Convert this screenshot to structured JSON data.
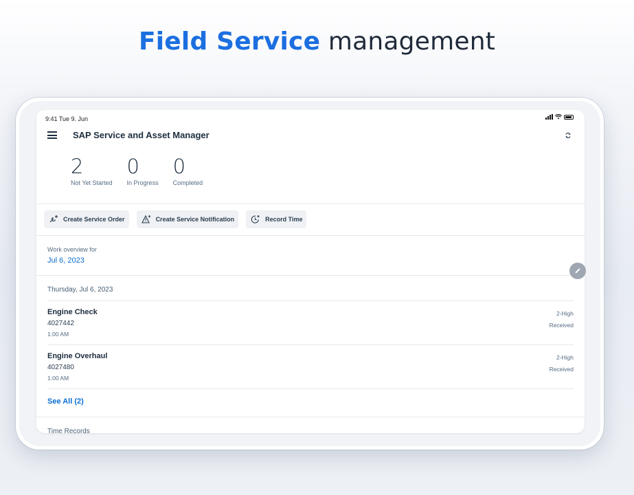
{
  "headline": {
    "accent": "Field Service",
    "rest": "management"
  },
  "status_bar": {
    "time": "9:41  Tue 9. Jun"
  },
  "app": {
    "title": "SAP Service and Asset Manager"
  },
  "kpis": [
    {
      "value": "2",
      "label": "Not Yet Started"
    },
    {
      "value": "0",
      "label": "In Progress"
    },
    {
      "value": "0",
      "label": "Completed"
    }
  ],
  "actions": [
    {
      "label": "Create Service Order",
      "icon": "wrench-plus-icon"
    },
    {
      "label": "Create Service Notification",
      "icon": "warning-plus-icon"
    },
    {
      "label": "Record Time",
      "icon": "clock-plus-icon"
    }
  ],
  "overview": {
    "label": "Work overview for",
    "date": "Jul 6, 2023"
  },
  "day_header": "Thursday, Jul 6, 2023",
  "orders": [
    {
      "title": "Engine Check",
      "id": "4027442",
      "time": "1:00 AM",
      "priority": "2-High",
      "status": "Received"
    },
    {
      "title": "Engine Overhaul",
      "id": "4027480",
      "time": "1:00 AM",
      "priority": "2-High",
      "status": "Received"
    }
  ],
  "see_all": "See All (2)",
  "next_section": "Time Records",
  "colors": {
    "accent": "#1b6fe0",
    "link": "#0a6ed1",
    "text": "#1d2d3e"
  }
}
